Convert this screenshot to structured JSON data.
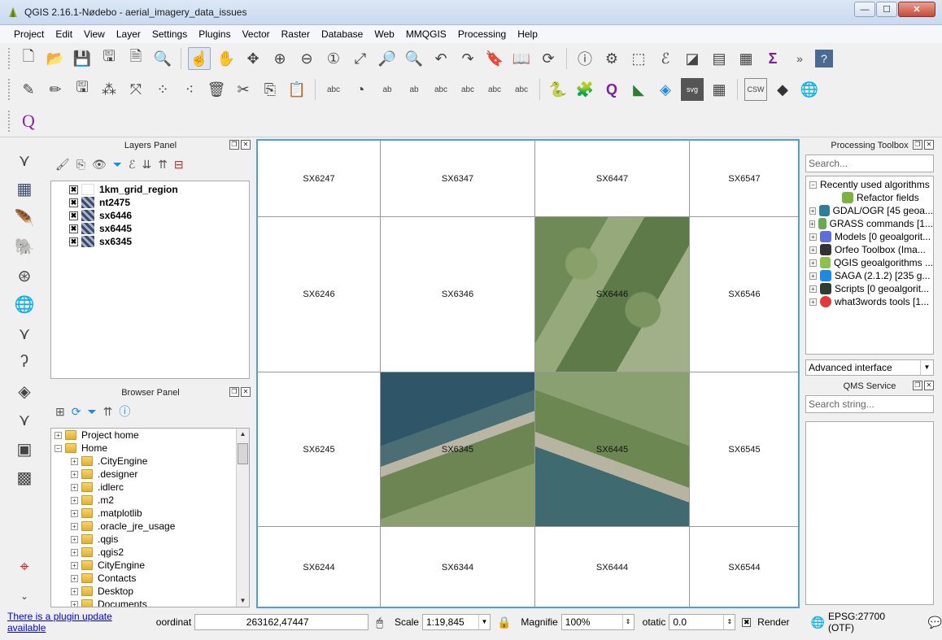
{
  "window": {
    "title": "QGIS 2.16.1-Nødebo - aerial_imagery_data_issues",
    "min": "—",
    "max": "☐",
    "close": "✕"
  },
  "menu": [
    "Project",
    "Edit",
    "View",
    "Layer",
    "Settings",
    "Plugins",
    "Vector",
    "Raster",
    "Database",
    "Web",
    "MMQGIS",
    "Processing",
    "Help"
  ],
  "layers_panel": {
    "title": "Layers Panel",
    "layers": [
      {
        "name": "1km_grid_region",
        "checked": "✖",
        "icon": "polygon-layer-icon"
      },
      {
        "name": "nt2475",
        "checked": "✖",
        "icon": "raster-layer-icon"
      },
      {
        "name": "sx6446",
        "checked": "✖",
        "icon": "raster-layer-icon"
      },
      {
        "name": "sx6445",
        "checked": "✖",
        "icon": "raster-layer-icon"
      },
      {
        "name": "sx6345",
        "checked": "✖",
        "icon": "raster-layer-icon"
      }
    ]
  },
  "browser_panel": {
    "title": "Browser Panel",
    "items": [
      {
        "label": "Project home",
        "expander": "+"
      },
      {
        "label": "Home",
        "expander": "−"
      },
      {
        "label": ".CityEngine",
        "expander": "+"
      },
      {
        "label": ".designer",
        "expander": "+"
      },
      {
        "label": ".idlerc",
        "expander": "+"
      },
      {
        "label": ".m2",
        "expander": "+"
      },
      {
        "label": ".matplotlib",
        "expander": "+"
      },
      {
        "label": ".oracle_jre_usage",
        "expander": "+"
      },
      {
        "label": ".qgis",
        "expander": "+"
      },
      {
        "label": ".qgis2",
        "expander": "+"
      },
      {
        "label": "CityEngine",
        "expander": "+"
      },
      {
        "label": "Contacts",
        "expander": "+"
      },
      {
        "label": "Desktop",
        "expander": "+"
      },
      {
        "label": "Documents",
        "expander": "+"
      }
    ]
  },
  "map": {
    "tiles": [
      [
        "SX6247",
        "SX6347",
        "SX6447",
        "SX6547"
      ],
      [
        "SX6246",
        "SX6346",
        "SX6446",
        "SX6546"
      ],
      [
        "SX6245",
        "SX6345",
        "SX6445",
        "SX6545"
      ],
      [
        "SX6244",
        "SX6344",
        "SX6444",
        "SX6544"
      ]
    ]
  },
  "processing_toolbox": {
    "title": "Processing Toolbox",
    "search_placeholder": "Search...",
    "tree": [
      {
        "label": "Recently used algorithms",
        "expander": "−",
        "icon_color": ""
      },
      {
        "label": "Refactor fields",
        "expander": "",
        "icon_color": "#7cb342"
      },
      {
        "label": "GDAL/OGR [45 geoa...",
        "expander": "+",
        "icon_color": "#2e7d9a"
      },
      {
        "label": "GRASS commands [1...",
        "expander": "+",
        "icon_color": "#6aa84f"
      },
      {
        "label": "Models [0 geoalgorit...",
        "expander": "+",
        "icon_color": "#5b6fd6"
      },
      {
        "label": "Orfeo Toolbox (Ima...",
        "expander": "+",
        "icon_color": "#333333"
      },
      {
        "label": "QGIS geoalgorithms ...",
        "expander": "+",
        "icon_color": "#8bc34a"
      },
      {
        "label": "SAGA (2.1.2) [235 g...",
        "expander": "+",
        "icon_color": "#1e88e5"
      },
      {
        "label": "Scripts [0 geoalgorit...",
        "expander": "+",
        "icon_color": "#2f3d2f"
      },
      {
        "label": "what3words tools [1...",
        "expander": "+",
        "icon_color": "#e53935"
      }
    ],
    "mode": "Advanced interface"
  },
  "qms_panel": {
    "title": "QMS Service",
    "search_placeholder": "Search string..."
  },
  "statusbar": {
    "plugin_update": "There is a plugin update available",
    "coord_label": "oordinat",
    "coord_value": "263162,47447",
    "scale_label": "Scale",
    "scale_value": "1:19,845",
    "magnifier_label": "Magnifie",
    "magnifier_value": "100%",
    "rotation_label": "otatic",
    "rotation_value": "0.0",
    "render_label": "Render",
    "render_checked": "✖",
    "crs": "EPSG:27700 (OTF)"
  }
}
